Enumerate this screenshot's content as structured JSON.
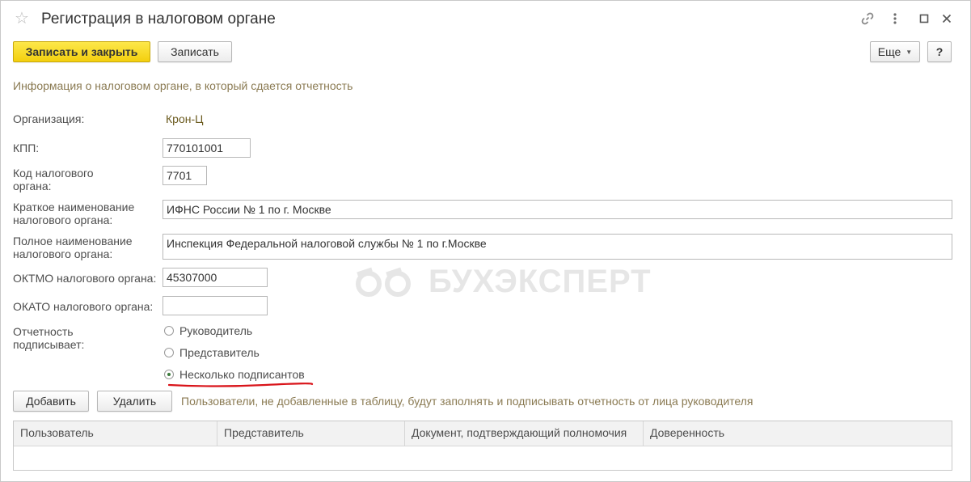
{
  "window": {
    "title": "Регистрация в налоговом органе"
  },
  "toolbar": {
    "save_close_label": "Записать и закрыть",
    "save_label": "Записать",
    "more_label": "Еще",
    "help_label": "?"
  },
  "info_text": "Информация о налоговом органе, в который сдается отчетность",
  "form": {
    "organization": {
      "label": "Организация:",
      "value": "Крон-Ц"
    },
    "kpp": {
      "label": "КПП:",
      "value": "770101001"
    },
    "tax_code": {
      "label_line1": "Код налогового",
      "label_line2": "органа:",
      "value": "7701"
    },
    "short_name": {
      "label_line1": "Краткое наименование",
      "label_line2": "налогового органа:",
      "value": "ИФНС России № 1 по г. Москве"
    },
    "full_name": {
      "label_line1": "Полное наименование",
      "label_line2": "налогового органа:",
      "value": "Инспекция Федеральной налоговой службы № 1 по г.Москве"
    },
    "oktmo": {
      "label": "ОКТМО налогового органа:",
      "value": "45307000"
    },
    "okato": {
      "label": "ОКАТО налогового органа:",
      "value": ""
    },
    "signer": {
      "label_line1": "Отчетность",
      "label_line2": "подписывает:",
      "options": [
        "Руководитель",
        "Представитель",
        "Несколько подписантов"
      ],
      "selected_index": 2
    }
  },
  "actions": {
    "add_label": "Добавить",
    "delete_label": "Удалить",
    "note": "Пользователи, не добавленные в таблицу, будут заполнять и подписывать отчетность от лица руководителя"
  },
  "table": {
    "columns": [
      "Пользователь",
      "Представитель",
      "Документ, подтверждающий полномочия",
      "Доверенность"
    ]
  },
  "watermark": {
    "text": "БУХЭКСПЕРТ"
  },
  "colors": {
    "primary_button": "#f3cf0e",
    "info_text": "#8a7a52",
    "underline": "#d9141a",
    "radio_dot": "#3a7a3a"
  }
}
